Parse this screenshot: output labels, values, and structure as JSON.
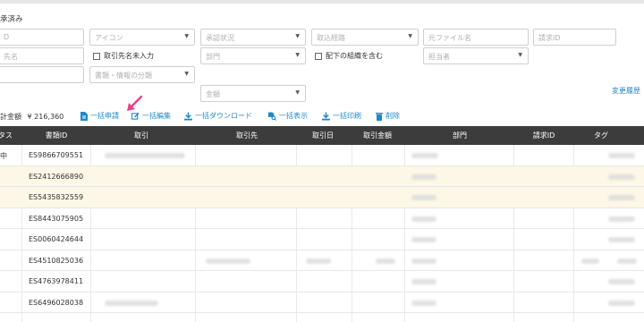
{
  "page": {
    "heading": "承済み",
    "history_link": "変更履歴"
  },
  "filters": {
    "id_placeholder": "D",
    "icon_placeholder": "アイコン",
    "status_placeholder": "承認状況",
    "route_placeholder": "取込経路",
    "filename_placeholder": "元ファイル名",
    "invoice_id_placeholder": "請求ID",
    "vendor_placeholder": "先名",
    "unentered_label": "取引先名未入力",
    "dept_placeholder": "部門",
    "subordinate_label": "配下の組織を含む",
    "owner_placeholder": "担当者",
    "doc_category_placeholder": "書類・情報の分類",
    "amount_placeholder": "金額"
  },
  "summary": {
    "total_label": "計金額",
    "total_value": "¥ 216,360"
  },
  "toolbar": {
    "bulk_request": "一括申請",
    "bulk_edit": "一括編集",
    "bulk_download": "一括ダウンロード",
    "bulk_view": "一括表示",
    "bulk_print": "一括印刷",
    "delete": "削除"
  },
  "table": {
    "columns": [
      "タス",
      "書類ID",
      "取引",
      "取引先",
      "取引日",
      "取引金額",
      "部門",
      "請求ID",
      "タグ"
    ],
    "rows": [
      {
        "status": "中",
        "doc_id": "ES9866709551",
        "highlight": false
      },
      {
        "status": "",
        "doc_id": "ES2412666890",
        "highlight": true
      },
      {
        "status": "",
        "doc_id": "ES5435832559",
        "highlight": true
      },
      {
        "status": "",
        "doc_id": "ES8443075905",
        "highlight": false
      },
      {
        "status": "",
        "doc_id": "ES0060424644",
        "highlight": false
      },
      {
        "status": "",
        "doc_id": "ES4510825036",
        "highlight": false
      },
      {
        "status": "",
        "doc_id": "ES4763978411",
        "highlight": false
      },
      {
        "status": "",
        "doc_id": "ES6496028038",
        "highlight": false
      }
    ]
  },
  "colors": {
    "accent": "#1e88c9",
    "header_bg": "#3c3c3c",
    "highlight_row": "#fcf7e6",
    "arrow": "#ef3f8a"
  }
}
